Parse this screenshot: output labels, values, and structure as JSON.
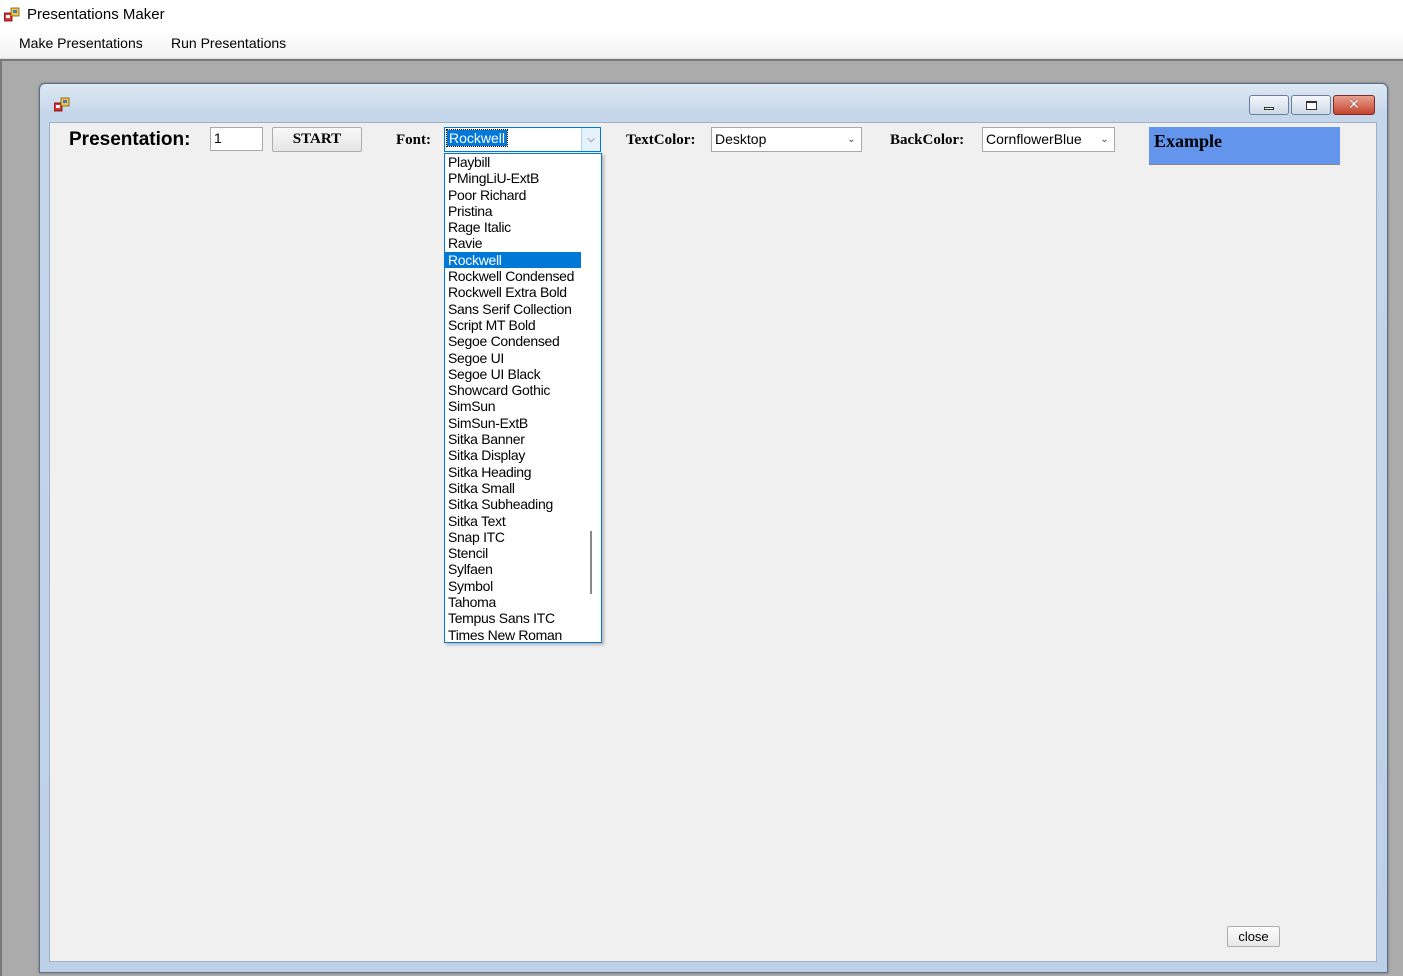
{
  "app": {
    "title": "Presentations Maker",
    "icon": "app-window-icon"
  },
  "menu": {
    "items": [
      {
        "label": "Make Presentations"
      },
      {
        "label": "Run Presentations"
      }
    ]
  },
  "form": {
    "presentation_label": "Presentation:",
    "presentation_value": "1",
    "start_label": "START",
    "font_label": "Font:",
    "font_value": "Rockwell",
    "textcolor_label": "TextColor:",
    "textcolor_value": "Desktop",
    "backcolor_label": "BackColor:",
    "backcolor_value": "CornflowerBlue",
    "example_label": "Example",
    "example_bg": "#6495ED",
    "close_label": "close"
  },
  "font_dropdown": {
    "selected": "Rockwell",
    "items": [
      "Playbill",
      "PMingLiU-ExtB",
      "Poor Richard",
      "Pristina",
      "Rage Italic",
      "Ravie",
      "Rockwell",
      "Rockwell Condensed",
      "Rockwell Extra Bold",
      "Sans Serif Collection",
      "Script MT Bold",
      "Segoe Condensed",
      "Segoe UI",
      "Segoe UI Black",
      "Showcard Gothic",
      "SimSun",
      "SimSun-ExtB",
      "Sitka Banner",
      "Sitka Display",
      "Sitka Heading",
      "Sitka Small",
      "Sitka Subheading",
      "Sitka Text",
      "Snap ITC",
      "Stencil",
      "Sylfaen",
      "Symbol",
      "Tahoma",
      "Tempus Sans ITC",
      "Times New Roman"
    ]
  },
  "colors": {
    "selection": "#0078D7",
    "client_bg": "#F0F0F0",
    "mdi_bg": "#ABABAB"
  }
}
